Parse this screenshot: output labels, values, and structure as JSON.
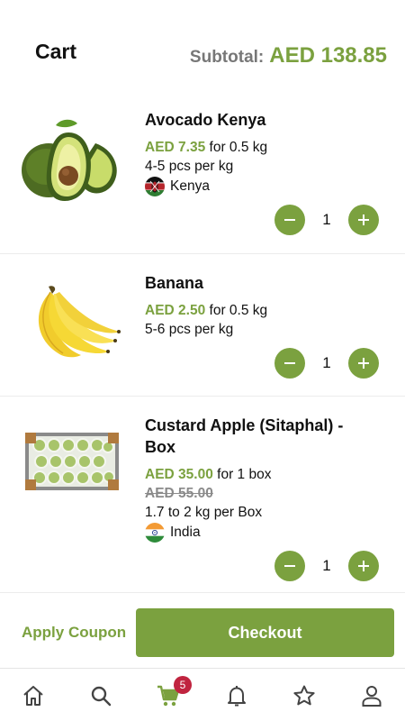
{
  "header": {
    "title": "Cart",
    "subtotal_label": "Subtotal:",
    "subtotal_value": "AED 138.85"
  },
  "items": [
    {
      "name": "Avocado Kenya",
      "price": "AED 7.35",
      "unit": "for 0.5 kg",
      "pieces": "4-5 pcs per kg",
      "origin": "Kenya",
      "quantity": "1"
    },
    {
      "name": "Banana",
      "price": "AED 2.50",
      "unit": "for 0.5 kg",
      "pieces": "5-6 pcs per kg",
      "quantity": "1"
    },
    {
      "name": "Custard Apple (Sitaphal) - Box",
      "price": "AED 35.00",
      "unit": "for 1 box",
      "old_price": "AED 55.00",
      "pieces": "1.7 to 2 kg per Box",
      "origin": "India",
      "quantity": "1"
    }
  ],
  "actions": {
    "apply_coupon": "Apply Coupon",
    "checkout": "Checkout"
  },
  "tabbar": {
    "cart_badge": "5",
    "active_tab": "cart",
    "icons": [
      "home-icon",
      "search-icon",
      "cart-icon",
      "bell-icon",
      "star-icon",
      "user-icon"
    ]
  },
  "colors": {
    "accent": "#7ba13f",
    "badge": "#c0243f",
    "muted": "#777777"
  }
}
